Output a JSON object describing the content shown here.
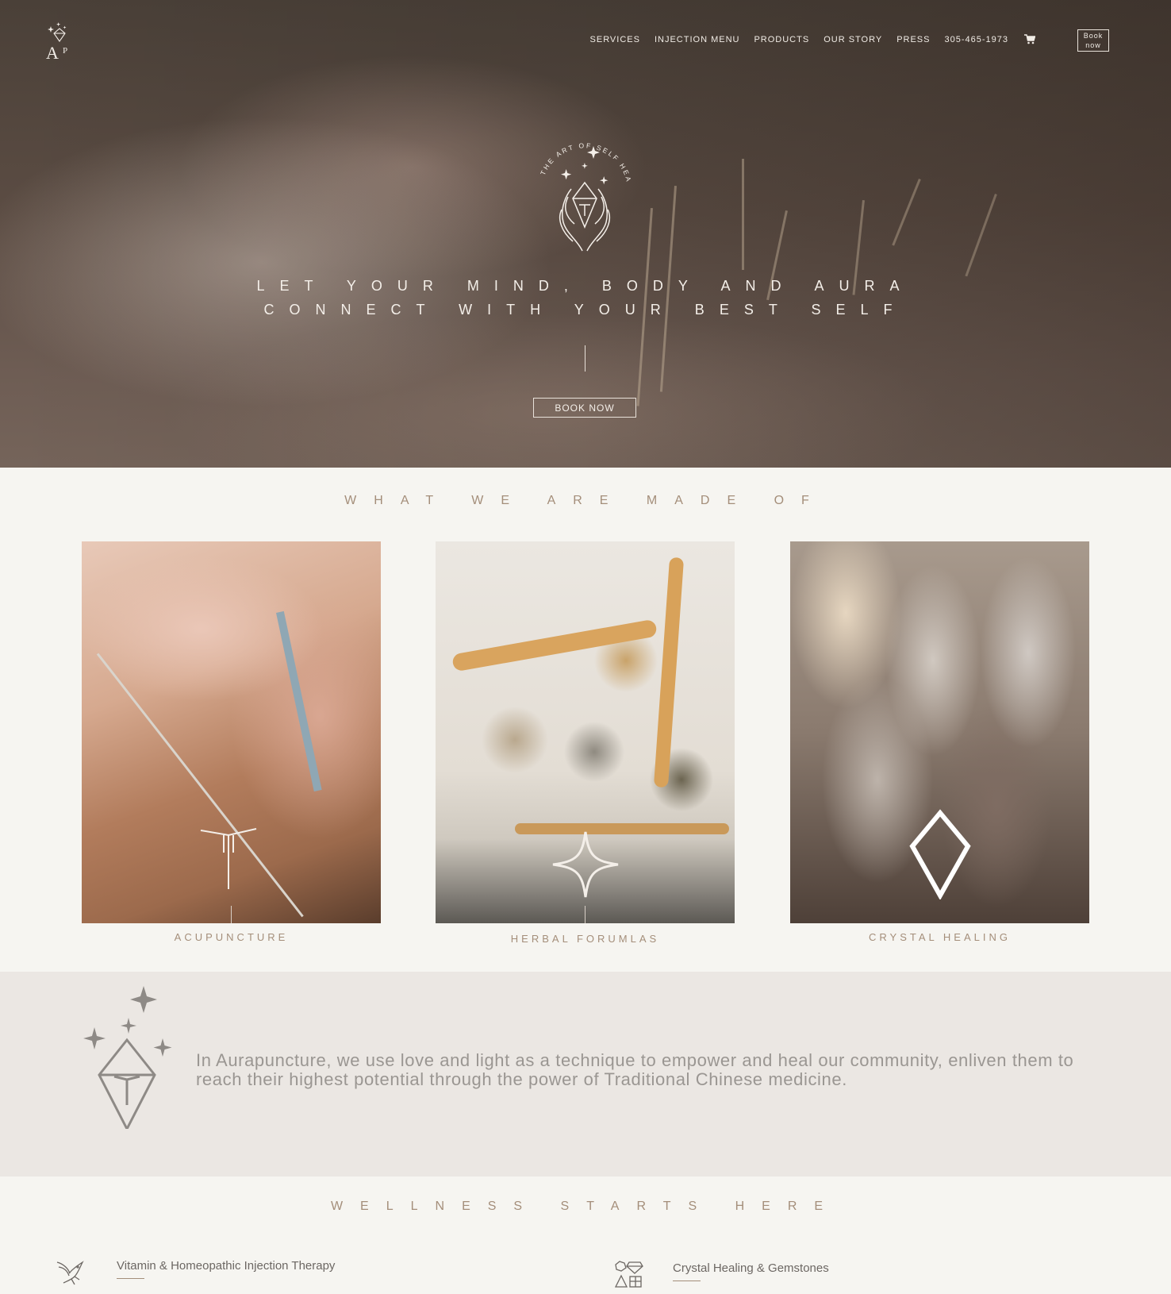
{
  "nav": {
    "items": [
      "SERVICES",
      "INJECTION MENU",
      "PRODUCTS",
      "OUR STORY",
      "PRESS",
      "305-465-1973"
    ],
    "cart_icon": "cart-icon",
    "book_label_line1": "Book",
    "book_label_line2": "now"
  },
  "hero": {
    "emblem_text": "THE ART OF SELF HEALING",
    "tagline_line1": "LET YOUR MIND, BODY AND AURA",
    "tagline_line2": "CONNECT WITH YOUR BEST SELF",
    "book_now": "BOOK NOW"
  },
  "made_of": {
    "title": "WHAT WE ARE MADE OF",
    "cards": [
      {
        "label": "ACUPUNCTURE",
        "icon": "needle-icon"
      },
      {
        "label": "HERBAL FORUMLAS",
        "icon": "sparkle-icon"
      },
      {
        "label": "CRYSTAL HEALING",
        "icon": "crystal-icon"
      }
    ]
  },
  "mission": {
    "icon": "crystal-stars-icon",
    "text": "In Aurapuncture, we use love and light as a technique to empower and heal our community, enliven them to reach their highest potential through the power of Traditional Chinese medicine."
  },
  "wellness": {
    "title": "WELLNESS STARTS HERE",
    "items": [
      {
        "label": "Vitamin & Homeopathic Injection Therapy",
        "icon": "hummingbird-icon"
      },
      {
        "label": "Crystal Healing & Gemstones",
        "icon": "gemstones-icon"
      }
    ]
  },
  "colors": {
    "accent": "#a48e7a",
    "hero_text": "#f4efe9",
    "background": "#f6f5f1",
    "mission_bg": "#ebe7e3"
  }
}
